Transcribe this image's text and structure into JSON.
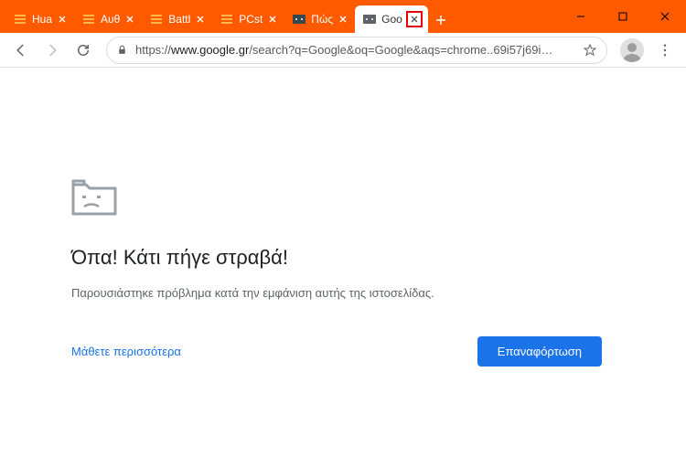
{
  "window": {
    "minimize": "_",
    "maximize": "☐",
    "close": "×"
  },
  "tabs": [
    {
      "label": "Hua",
      "icon": "orange"
    },
    {
      "label": "Αυθ",
      "icon": "orange"
    },
    {
      "label": "Battl",
      "icon": "orange"
    },
    {
      "label": "PCst",
      "icon": "orange"
    },
    {
      "label": "Πώς",
      "icon": "dark"
    },
    {
      "label": "Goo",
      "icon": "dark",
      "active": true
    }
  ],
  "newtab": "+",
  "address": {
    "scheme": "https://",
    "host": "www.google.gr",
    "path": "/search?q=Google&oq=Google&aqs=chrome..69i57j69i…"
  },
  "error": {
    "title": "Όπα! Κάτι πήγε στραβά!",
    "message": "Παρουσιάστηκε πρόβλημα κατά την εμφάνιση αυτής της ιστοσελίδας.",
    "learn_more": "Μάθετε περισσότερα",
    "reload": "Επαναφόρτωση"
  }
}
